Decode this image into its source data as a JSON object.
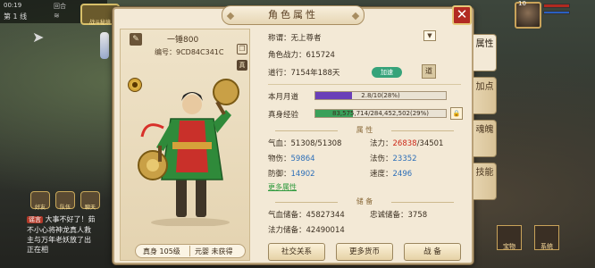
{
  "status_bar": {
    "time": "00:19",
    "line": "第 1 线",
    "back": "回合"
  },
  "shield_label": "战斗秘境",
  "chat": {
    "icons": [
      "好友",
      "队伍",
      "聊天"
    ],
    "tag": "谣言",
    "lines": [
      "大事不好了！茹",
      "不小心将神龙真人救",
      "主与万年老妖放了出",
      "正在相"
    ]
  },
  "player_hud": {
    "level": "10"
  },
  "side_buttons": [
    "宝物",
    "系统"
  ],
  "panel": {
    "title": "角色属性",
    "close": "✕",
    "name": "一锤800",
    "id_label": "编号：",
    "id_value": "9CD84C341C",
    "zhen_label": "真",
    "level_bar": {
      "realm": "真身 105级",
      "yuanying": "元婴 未获得"
    }
  },
  "info": {
    "title_label": "称谓：",
    "title_value": "无上尊者",
    "power_label": "角色战力：",
    "power_value": "615724",
    "daoxing_label": "道行：",
    "daoxing_value": "7154年188天",
    "daoxing_badge": "加速",
    "daoxing_btn": "道",
    "monthly_label": "本月月道",
    "monthly_text": "2.8/10(28%)",
    "monthly_pct": 28,
    "exp_label": "真身经验",
    "exp_text": "83,575,714/284,452,502(29%)",
    "exp_pct": 29,
    "attr_section": "属 性",
    "hp_label": "气血：",
    "hp_value": "51308/51308",
    "mp_label": "法力：",
    "mp_value_a": "26838",
    "mp_value_b": "/34501",
    "phys_atk_label": "物伤：",
    "phys_atk_value": "59864",
    "mag_atk_label": "法伤：",
    "mag_atk_value": "23352",
    "def_label": "防御：",
    "def_value": "14902",
    "speed_label": "速度：",
    "speed_value": "2496",
    "more_attr": "更多属性",
    "store_section": "储 备",
    "hp_store_label": "气血储备：",
    "hp_store_value": "45827344",
    "loyal_store_label": "忠诚储备：",
    "loyal_store_value": "3758",
    "mp_store_label": "法力储备：",
    "mp_store_value": "42490014",
    "btn_social": "社交关系",
    "btn_currency": "更多货币",
    "btn_battle": "战  备"
  },
  "tabs": [
    "属性",
    "加点",
    "魂魄",
    "技能"
  ],
  "colors": {
    "monthly_fill": "#6a3fb8",
    "exp_fill": "#3aa05a",
    "close_bg": "#b22a22"
  }
}
